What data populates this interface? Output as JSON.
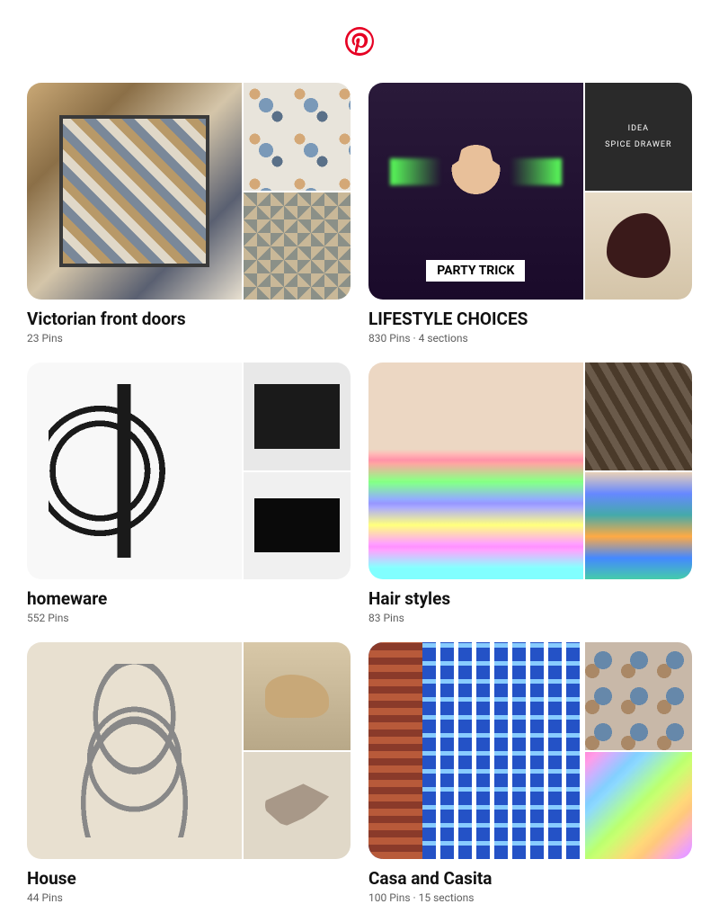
{
  "brand": {
    "name": "Pinterest",
    "color": "#E60023"
  },
  "boards": [
    {
      "title": "Victorian front doors",
      "pin_count": 23,
      "meta": "23 Pins",
      "images": [
        "tiles-1",
        "tiles-2",
        "tiles-3"
      ]
    },
    {
      "title": "LIFESTYLE CHOICES",
      "pin_count": 830,
      "sections": 4,
      "meta": "830 Pins · 4 sections",
      "images": [
        "party",
        "spice",
        "shoe"
      ]
    },
    {
      "title": "homeware",
      "pin_count": 552,
      "meta": "552 Pins",
      "images": [
        "bike",
        "audio-1",
        "audio-2"
      ]
    },
    {
      "title": "Hair styles",
      "pin_count": 83,
      "meta": "83 Pins",
      "images": [
        "hair-rainbow",
        "braid",
        "hair-ext"
      ]
    },
    {
      "title": "House",
      "pin_count": 44,
      "meta": "44 Pins",
      "images": [
        "shelf",
        "hippo",
        "tentacle"
      ]
    },
    {
      "title": "Casa and Casita",
      "pin_count": 100,
      "sections": 15,
      "meta": "100 Pins · 15 sections",
      "images": [
        "fountain",
        "mosaic",
        "iridescent"
      ]
    }
  ]
}
